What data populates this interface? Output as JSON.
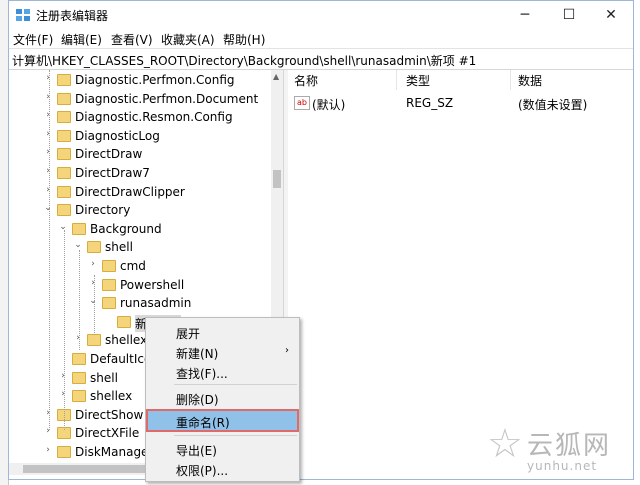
{
  "window": {
    "title": "注册表编辑器"
  },
  "window_controls": {
    "minimize": "─",
    "maximize": "☐",
    "close": "✕"
  },
  "menu": [
    "文件(F)",
    "编辑(E)",
    "查看(V)",
    "收藏夹(A)",
    "帮助(H)"
  ],
  "address": "计算机\\HKEY_CLASSES_ROOT\\Directory\\Background\\shell\\runasadmin\\新项 #1",
  "tree": [
    {
      "label": "Diagnostic.Perfmon.Config",
      "indent": 0,
      "toggle": ">"
    },
    {
      "label": "Diagnostic.Perfmon.Document",
      "indent": 0,
      "toggle": ">"
    },
    {
      "label": "Diagnostic.Resmon.Config",
      "indent": 0,
      "toggle": ">"
    },
    {
      "label": "DiagnosticLog",
      "indent": 0,
      "toggle": ">"
    },
    {
      "label": "DirectDraw",
      "indent": 0,
      "toggle": ">"
    },
    {
      "label": "DirectDraw7",
      "indent": 0,
      "toggle": ">"
    },
    {
      "label": "DirectDrawClipper",
      "indent": 0,
      "toggle": ">"
    },
    {
      "label": "Directory",
      "indent": 0,
      "toggle": "v"
    },
    {
      "label": "Background",
      "indent": 1,
      "toggle": "v"
    },
    {
      "label": "shell",
      "indent": 2,
      "toggle": "v"
    },
    {
      "label": "cmd",
      "indent": 3,
      "toggle": ">"
    },
    {
      "label": "Powershell",
      "indent": 3,
      "toggle": ">"
    },
    {
      "label": "runasadmin",
      "indent": 3,
      "toggle": "v"
    },
    {
      "label": "新项 #1",
      "indent": 4,
      "toggle": "",
      "selected": true
    },
    {
      "label": "shellex",
      "indent": 2,
      "toggle": ">"
    },
    {
      "label": "DefaultIcon",
      "indent": 1,
      "toggle": ""
    },
    {
      "label": "shell",
      "indent": 1,
      "toggle": ">"
    },
    {
      "label": "shellex",
      "indent": 1,
      "toggle": ">"
    },
    {
      "label": "DirectShow",
      "indent": 0,
      "toggle": ">"
    },
    {
      "label": "DirectXFile",
      "indent": 0,
      "toggle": ">"
    },
    {
      "label": "DiskManagement",
      "indent": 0,
      "toggle": ">"
    }
  ],
  "columns": [
    "名称",
    "类型",
    "数据"
  ],
  "values": [
    {
      "name": "(默认)",
      "type": "REG_SZ",
      "data": "(数值未设置)"
    }
  ],
  "context_menu": [
    {
      "label": "展开"
    },
    {
      "label": "新建(N)",
      "submenu": true
    },
    {
      "label": "查找(F)..."
    },
    {
      "label": "删除(D)"
    },
    {
      "label": "重命名(R)",
      "highlighted": true
    },
    {
      "label": "导出(E)"
    },
    {
      "label": "权限(P)..."
    }
  ],
  "watermark": {
    "brand": "云狐网",
    "url": "yunhu.net"
  }
}
